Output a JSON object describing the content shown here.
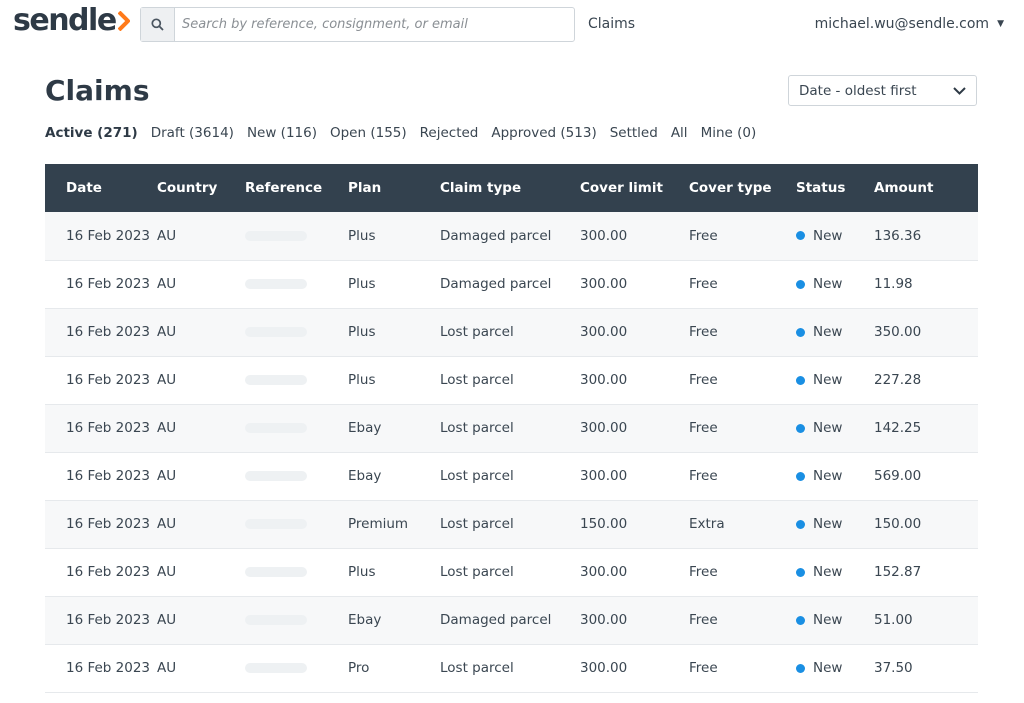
{
  "header": {
    "logo_text": "sendle",
    "search_placeholder": "Search by reference, consignment, or email",
    "nav_claims": "Claims",
    "user_email": "michael.wu@sendle.com"
  },
  "page": {
    "title": "Claims",
    "sort_selected": "Date - oldest first"
  },
  "filters": [
    {
      "label": "Active (271)",
      "active": true
    },
    {
      "label": "Draft (3614)",
      "active": false
    },
    {
      "label": "New (116)",
      "active": false
    },
    {
      "label": "Open (155)",
      "active": false
    },
    {
      "label": "Rejected",
      "active": false
    },
    {
      "label": "Approved (513)",
      "active": false
    },
    {
      "label": "Settled",
      "active": false
    },
    {
      "label": "All",
      "active": false
    },
    {
      "label": "Mine (0)",
      "active": false
    }
  ],
  "table": {
    "columns": [
      "Date",
      "Country",
      "Reference",
      "Plan",
      "Claim type",
      "Cover limit",
      "Cover type",
      "Status",
      "Amount"
    ],
    "rows": [
      {
        "date": "16 Feb 2023",
        "country": "AU",
        "plan": "Plus",
        "claim_type": "Damaged parcel",
        "cover_limit": "300.00",
        "cover_type": "Free",
        "status": "New",
        "amount": "136.36"
      },
      {
        "date": "16 Feb 2023",
        "country": "AU",
        "plan": "Plus",
        "claim_type": "Damaged parcel",
        "cover_limit": "300.00",
        "cover_type": "Free",
        "status": "New",
        "amount": "11.98"
      },
      {
        "date": "16 Feb 2023",
        "country": "AU",
        "plan": "Plus",
        "claim_type": "Lost parcel",
        "cover_limit": "300.00",
        "cover_type": "Free",
        "status": "New",
        "amount": "350.00"
      },
      {
        "date": "16 Feb 2023",
        "country": "AU",
        "plan": "Plus",
        "claim_type": "Lost parcel",
        "cover_limit": "300.00",
        "cover_type": "Free",
        "status": "New",
        "amount": "227.28"
      },
      {
        "date": "16 Feb 2023",
        "country": "AU",
        "plan": "Ebay",
        "claim_type": "Lost parcel",
        "cover_limit": "300.00",
        "cover_type": "Free",
        "status": "New",
        "amount": "142.25"
      },
      {
        "date": "16 Feb 2023",
        "country": "AU",
        "plan": "Ebay",
        "claim_type": "Lost parcel",
        "cover_limit": "300.00",
        "cover_type": "Free",
        "status": "New",
        "amount": "569.00"
      },
      {
        "date": "16 Feb 2023",
        "country": "AU",
        "plan": "Premium",
        "claim_type": "Lost parcel",
        "cover_limit": "150.00",
        "cover_type": "Extra",
        "status": "New",
        "amount": "150.00"
      },
      {
        "date": "16 Feb 2023",
        "country": "AU",
        "plan": "Plus",
        "claim_type": "Lost parcel",
        "cover_limit": "300.00",
        "cover_type": "Free",
        "status": "New",
        "amount": "152.87"
      },
      {
        "date": "16 Feb 2023",
        "country": "AU",
        "plan": "Ebay",
        "claim_type": "Damaged parcel",
        "cover_limit": "300.00",
        "cover_type": "Free",
        "status": "New",
        "amount": "51.00"
      },
      {
        "date": "16 Feb 2023",
        "country": "AU",
        "plan": "Pro",
        "claim_type": "Lost parcel",
        "cover_limit": "300.00",
        "cover_type": "Free",
        "status": "New",
        "amount": "37.50"
      }
    ]
  },
  "colors": {
    "header_bg": "#33414e",
    "status_new": "#1a8fe3",
    "logo_accent": "#ff7a1a"
  },
  "icons": {
    "search": "search-icon",
    "logo_chevron": "chevron-right-icon",
    "user_caret": "caret-down-icon",
    "sort_chevron": "chevron-down-icon"
  }
}
